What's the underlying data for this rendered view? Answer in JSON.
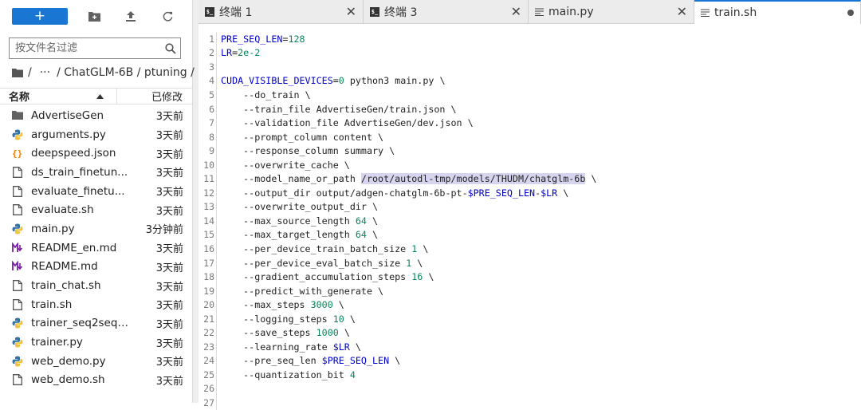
{
  "toolbar": {
    "new_label": "+",
    "icons": [
      "new-folder-icon",
      "upload-icon",
      "refresh-icon"
    ]
  },
  "filter": {
    "placeholder": "按文件名过滤"
  },
  "breadcrumb": {
    "ellipsis": "···",
    "path": "/ ChatGLM-6B / ptuning /",
    "sep": "/"
  },
  "list_header": {
    "name": "名称",
    "modified": "已修改"
  },
  "files": [
    {
      "name": "AdvertiseGen",
      "modified": "3天前",
      "icon": "folder-icon"
    },
    {
      "name": "arguments.py",
      "modified": "3天前",
      "icon": "python-icon"
    },
    {
      "name": "deepspeed.json",
      "modified": "3天前",
      "icon": "json-icon"
    },
    {
      "name": "ds_train_finetun...",
      "modified": "3天前",
      "icon": "file-icon"
    },
    {
      "name": "evaluate_finetu...",
      "modified": "3天前",
      "icon": "file-icon"
    },
    {
      "name": "evaluate.sh",
      "modified": "3天前",
      "icon": "file-icon"
    },
    {
      "name": "main.py",
      "modified": "3分钟前",
      "icon": "python-icon"
    },
    {
      "name": "README_en.md",
      "modified": "3天前",
      "icon": "markdown-icon"
    },
    {
      "name": "README.md",
      "modified": "3天前",
      "icon": "markdown-icon"
    },
    {
      "name": "train_chat.sh",
      "modified": "3天前",
      "icon": "file-icon"
    },
    {
      "name": "train.sh",
      "modified": "3天前",
      "icon": "file-icon"
    },
    {
      "name": "trainer_seq2seq....",
      "modified": "3天前",
      "icon": "python-icon"
    },
    {
      "name": "trainer.py",
      "modified": "3天前",
      "icon": "python-icon"
    },
    {
      "name": "web_demo.py",
      "modified": "3天前",
      "icon": "python-icon"
    },
    {
      "name": "web_demo.sh",
      "modified": "3天前",
      "icon": "file-icon"
    }
  ],
  "tabs": [
    {
      "label": "终端 1",
      "icon": "terminal-icon",
      "active": false
    },
    {
      "label": "终端 3",
      "icon": "terminal-icon",
      "active": false
    },
    {
      "label": "main.py",
      "icon": "text-file-icon",
      "active": false
    },
    {
      "label": "train.sh",
      "icon": "text-file-icon",
      "active": true,
      "modified": true
    }
  ],
  "code_lines": [
    [
      [
        "var",
        "PRE_SEQ_LEN"
      ],
      [
        "",
        "="
      ],
      [
        "num",
        "128"
      ]
    ],
    [
      [
        "var",
        "LR"
      ],
      [
        "",
        "="
      ],
      [
        "num",
        "2e-2"
      ]
    ],
    [],
    [
      [
        "var",
        "CUDA_VISIBLE_DEVICES"
      ],
      [
        "",
        "="
      ],
      [
        "num",
        "0"
      ],
      [
        "",
        " python3 main.py \\"
      ]
    ],
    [
      [
        "",
        "    --do_train \\"
      ]
    ],
    [
      [
        "",
        "    --train_file AdvertiseGen/train.json \\"
      ]
    ],
    [
      [
        "",
        "    --validation_file AdvertiseGen/dev.json \\"
      ]
    ],
    [
      [
        "",
        "    --prompt_column content \\"
      ]
    ],
    [
      [
        "",
        "    --response_column summary \\"
      ]
    ],
    [
      [
        "",
        "    --overwrite_cache \\"
      ]
    ],
    [
      [
        "",
        "    --model_name_or_path "
      ],
      [
        "hl",
        "/root/autodl-tmp/models/THUDM/chatglm-6b"
      ],
      [
        "",
        " \\"
      ]
    ],
    [
      [
        "",
        "    --output_dir output/adgen-chatglm-6b-pt-"
      ],
      [
        "var",
        "$PRE_SEQ_LEN"
      ],
      [
        "",
        "-"
      ],
      [
        "var",
        "$LR"
      ],
      [
        "",
        " \\"
      ]
    ],
    [
      [
        "",
        "    --overwrite_output_dir \\"
      ]
    ],
    [
      [
        "",
        "    --max_source_length "
      ],
      [
        "num",
        "64"
      ],
      [
        "",
        " \\"
      ]
    ],
    [
      [
        "",
        "    --max_target_length "
      ],
      [
        "num",
        "64"
      ],
      [
        "",
        " \\"
      ]
    ],
    [
      [
        "",
        "    --per_device_train_batch_size "
      ],
      [
        "num",
        "1"
      ],
      [
        "",
        " \\"
      ]
    ],
    [
      [
        "",
        "    --per_device_eval_batch_size "
      ],
      [
        "num",
        "1"
      ],
      [
        "",
        " \\"
      ]
    ],
    [
      [
        "",
        "    --gradient_accumulation_steps "
      ],
      [
        "num",
        "16"
      ],
      [
        "",
        " \\"
      ]
    ],
    [
      [
        "",
        "    --predict_with_generate \\"
      ]
    ],
    [
      [
        "",
        "    --max_steps "
      ],
      [
        "num",
        "3000"
      ],
      [
        "",
        " \\"
      ]
    ],
    [
      [
        "",
        "    --logging_steps "
      ],
      [
        "num",
        "10"
      ],
      [
        "",
        " \\"
      ]
    ],
    [
      [
        "",
        "    --save_steps "
      ],
      [
        "num",
        "1000"
      ],
      [
        "",
        " \\"
      ]
    ],
    [
      [
        "",
        "    --learning_rate "
      ],
      [
        "var",
        "$LR"
      ],
      [
        "",
        " \\"
      ]
    ],
    [
      [
        "",
        "    --pre_seq_len "
      ],
      [
        "var",
        "$PRE_SEQ_LEN"
      ],
      [
        "",
        " \\"
      ]
    ],
    [
      [
        "",
        "    --quantization_bit "
      ],
      [
        "num",
        "4"
      ]
    ],
    [],
    []
  ],
  "colors": {
    "accent": "#1976d2",
    "variable": "#0000cc",
    "number": "#098658",
    "selection": "#d7d4f0"
  }
}
